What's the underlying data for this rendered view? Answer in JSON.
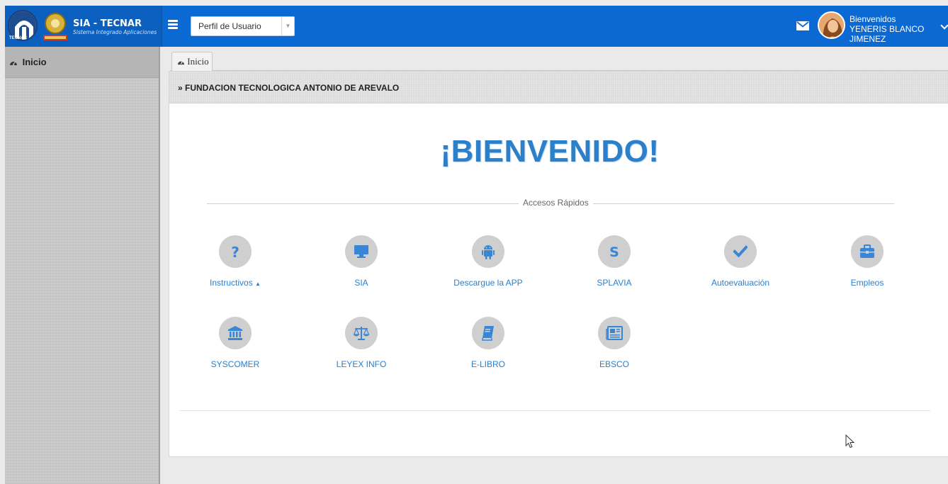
{
  "app": {
    "title": "SIA - TECNAR",
    "subtitle": "Sistema Integrado Aplicaciones",
    "logo_text": "TECNAR"
  },
  "header": {
    "profile_select_value": "Perfil de Usuario",
    "greeting": "Bienvenidos",
    "user_name": "YENERIS BLANCO JIMENEZ"
  },
  "sidebar": {
    "items": [
      {
        "label": "Inicio",
        "icon": "dashboard-icon"
      }
    ]
  },
  "tabs": [
    {
      "label": "Inicio",
      "icon": "dashboard-icon"
    }
  ],
  "main": {
    "breadcrumb": "» FUNDACION TECNOLOGICA ANTONIO DE AREVALO",
    "welcome": "¡BIENVENIDO!",
    "section_title": "Accesos Rápidos",
    "quick_links": [
      {
        "label": "Instructivos",
        "icon": "question-icon",
        "suffix": "▲"
      },
      {
        "label": "SIA",
        "icon": "monitor-icon"
      },
      {
        "label": "Descargue la APP",
        "icon": "android-icon"
      },
      {
        "label": "SPLAVIA",
        "icon": "letter-s-icon"
      },
      {
        "label": "Autoevaluación",
        "icon": "check-icon"
      },
      {
        "label": "Empleos",
        "icon": "briefcase-icon"
      },
      {
        "label": "SYSCOMER",
        "icon": "bank-icon"
      },
      {
        "label": "LEYEX INFO",
        "icon": "balance-scale-icon"
      },
      {
        "label": "E-LIBRO",
        "icon": "book-icon"
      },
      {
        "label": "EBSCO",
        "icon": "newspaper-icon"
      }
    ]
  },
  "colors": {
    "topbar": "#0a69d3",
    "link": "#2a7fd0",
    "welcome": "#2c7fc9",
    "icon_circle": "#cfcfcf",
    "icon_glyph": "#3a86d6"
  }
}
